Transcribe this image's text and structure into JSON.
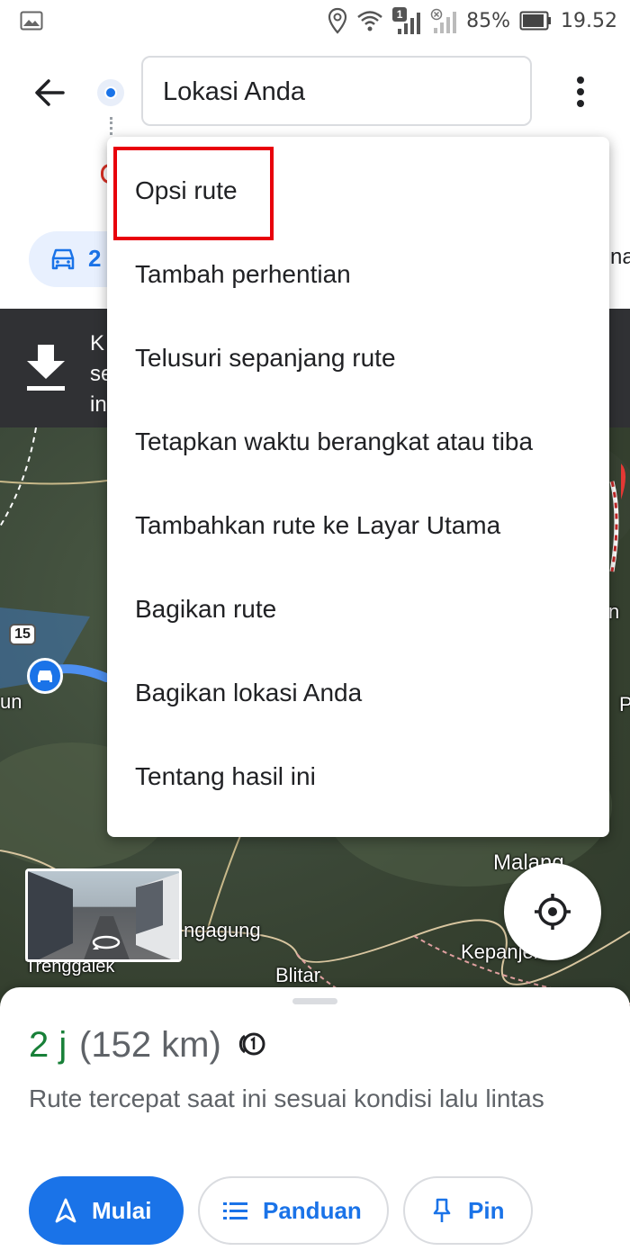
{
  "status_bar": {
    "battery_percent": "85%",
    "time": "19.52",
    "sim_badge": "1",
    "icons": [
      "gallery-icon",
      "location-icon",
      "wifi-icon",
      "signal-icon",
      "signal-off-icon",
      "battery-icon"
    ]
  },
  "header": {
    "origin_value": "Lokasi Anda",
    "icons": [
      "back-arrow-icon",
      "origin-dot-icon",
      "more-vert-icon"
    ]
  },
  "travel_modes": {
    "driving_value": "2",
    "edge_text": "na"
  },
  "offline_banner": {
    "icon": "download-icon",
    "text_lines": [
      "K",
      "se",
      "in"
    ]
  },
  "overflow_menu": {
    "items": [
      {
        "label": "Opsi rute",
        "highlighted": true
      },
      {
        "label": "Tambah perhentian"
      },
      {
        "label": "Telusuri sepanjang rute"
      },
      {
        "label": "Tetapkan waktu berangkat atau tiba"
      },
      {
        "label": "Tambahkan rute ke Layar Utama"
      },
      {
        "label": "Bagikan rute"
      },
      {
        "label": "Bagikan lokasi Anda"
      },
      {
        "label": "Tentang hasil ini"
      }
    ],
    "highlight_color": "#e8000b"
  },
  "map": {
    "labels": {
      "malang": "Malang",
      "ngagung": "ngagung",
      "kepanjen": "Kepanjen",
      "blitar": "Blitar",
      "trenggalek": "Trenggalek",
      "un": "un",
      "p": "P",
      "n": "n"
    },
    "road_shield": "15",
    "icons": [
      "car-marker-icon",
      "street-view-rotate-icon",
      "my-location-icon"
    ]
  },
  "route_sheet": {
    "duration": "2 j",
    "distance": "(152 km)",
    "description": "Rute tercepat saat ini sesuai kondisi lalu lintas",
    "buttons": {
      "start": "Mulai",
      "steps": "Panduan",
      "pin": "Pin"
    }
  },
  "colors": {
    "accent": "#1a73e8",
    "duration_green": "#188038",
    "banner_dark": "#303134"
  }
}
